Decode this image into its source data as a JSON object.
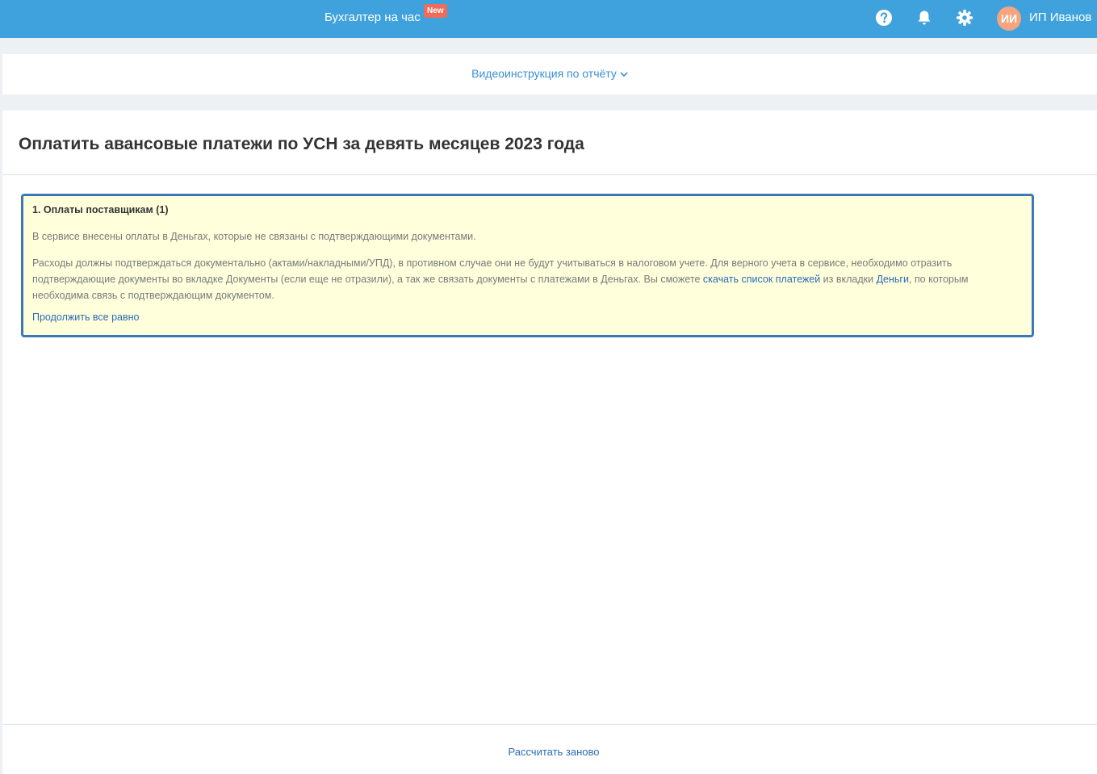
{
  "header": {
    "promo_label": "Бухгалтер на час",
    "promo_badge": "New",
    "help_icon": "help-icon",
    "notifications_icon": "bell-icon",
    "settings_icon": "gear-icon",
    "avatar_initials": "ИИ",
    "user_name": "ИП Иванов",
    "colors": {
      "bar": "#3fa2dd",
      "badge": "#ef6c5a",
      "avatar": "#f4a57f"
    }
  },
  "video": {
    "link_label": "Видеоинструкция по отчёту"
  },
  "main": {
    "title": "Оплатить авансовые платежи по УСН за девять месяцев 2023 года",
    "warning": {
      "title": "1. Оплаты поставщикам (1)",
      "text1": "В сервисе внесены оплаты в Деньгах, которые не связаны с подтверждающими документами.",
      "text2_part1": "Расходы должны подтверждаться документально (актами/накладными/УПД), в противном случае они не будут учитываться в налоговом учете. Для верного учета в сервисе, необходимо отразить подтверждающие документы во вкладке Документы (если еще не отразили), а так же связать документы с платежами в Деньгах. Вы сможете ",
      "text2_link1": "скачать список платежей",
      "text2_part2": " из вкладки ",
      "text2_link2": "Деньги",
      "text2_part3": ", по которым необходима связь с подтверждающим документом.",
      "continue_label": "Продолжить все равно",
      "colors": {
        "background": "#ffffdc",
        "border": "#3b78b7"
      }
    },
    "recalc_label": "Рассчитать заново"
  }
}
